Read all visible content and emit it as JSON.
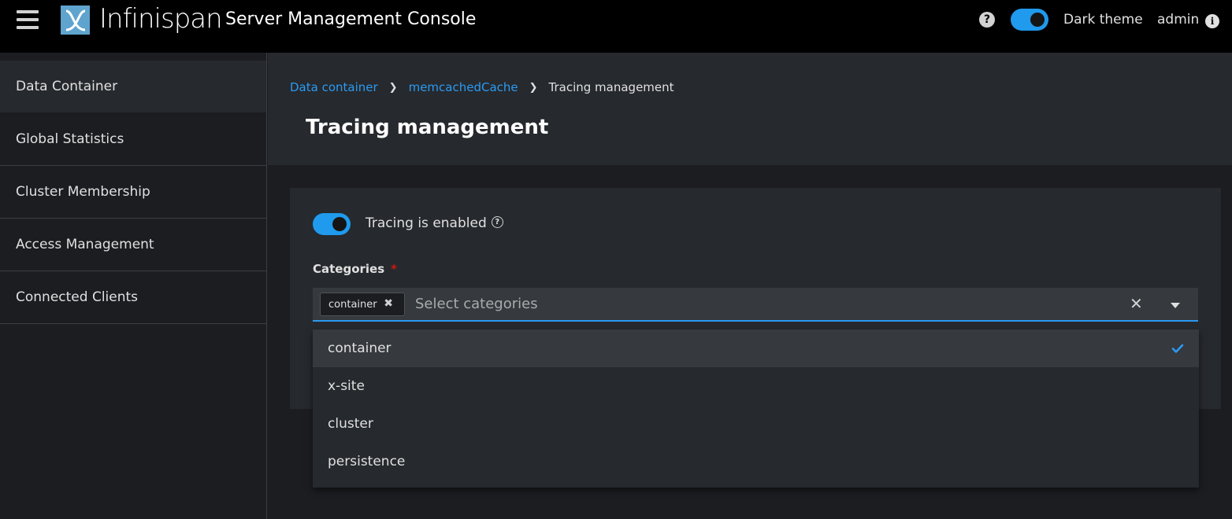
{
  "masthead": {
    "logo_text": "Infinispan",
    "app_title": "Server Management Console",
    "help_icon_glyph": "?",
    "dark_theme_label": "Dark theme",
    "dark_theme_on": true,
    "user_label": "admin",
    "info_icon_glyph": "i",
    "accent_color": "#1f9aed"
  },
  "sidebar": {
    "items": [
      {
        "label": "Data Container",
        "active": true
      },
      {
        "label": "Global Statistics",
        "active": false
      },
      {
        "label": "Cluster Membership",
        "active": false
      },
      {
        "label": "Access Management",
        "active": false
      },
      {
        "label": "Connected Clients",
        "active": false
      }
    ]
  },
  "breadcrumb": {
    "items": [
      "Data container",
      "memcachedCache",
      "Tracing management"
    ],
    "separator": "❯"
  },
  "page": {
    "title": "Tracing management"
  },
  "tracing": {
    "toggle_label": "Tracing is enabled",
    "enabled": true,
    "help_glyph": "?"
  },
  "categories": {
    "label": "Categories",
    "required_marker": "*",
    "chips": [
      "container"
    ],
    "chip_remove_glyph": "✖",
    "placeholder": "Select categories",
    "clear_glyph": "✕",
    "options": [
      {
        "label": "container",
        "selected": true
      },
      {
        "label": "x-site",
        "selected": false
      },
      {
        "label": "cluster",
        "selected": false
      },
      {
        "label": "persistence",
        "selected": false
      }
    ]
  }
}
